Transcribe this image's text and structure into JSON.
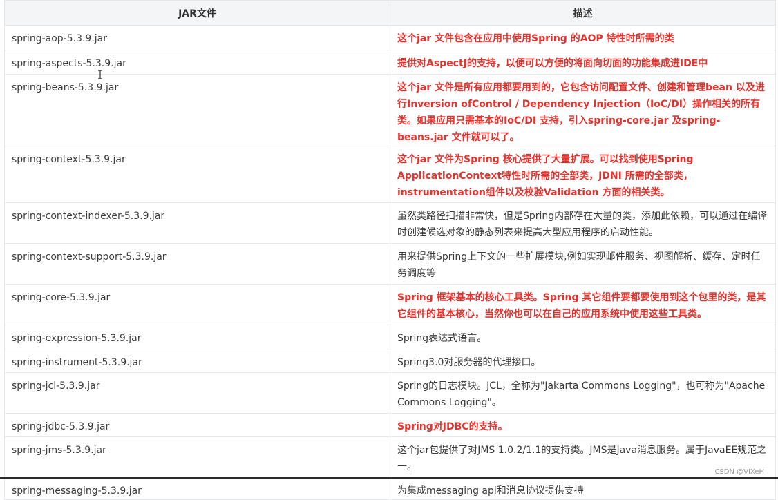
{
  "table": {
    "headers": [
      "JAR文件",
      "描述"
    ],
    "rows": [
      {
        "jar": "spring-aop-5.3.9.jar",
        "desc": "这个jar 文件包含在应用中使用Spring 的AOP 特性时所需的类",
        "highlight": true
      },
      {
        "jar": "spring-aspects-5.3.9.jar",
        "desc": "提供对AspectJ的支持，以便可以方便的将面向切面的功能集成进IDE中",
        "highlight": true
      },
      {
        "jar": "spring-beans-5.3.9.jar",
        "desc": "这个jar 文件是所有应用都要用到的，它包含访问配置文件、创建和管理bean 以及进行Inversion ofControl / Dependency Injection（IoC/DI）操作相关的所有类。如果应用只需基本的IoC/DI 支持，引入spring-core.jar 及spring-beans.jar 文件就可以了。",
        "highlight": true
      },
      {
        "jar": "spring-context-5.3.9.jar",
        "desc": "这个jar 文件为Spring 核心提供了大量扩展。可以找到使用Spring ApplicationContext特性时所需的全部类，JDNI 所需的全部类，instrumentation组件以及校验Validation 方面的相关类。",
        "highlight": true
      },
      {
        "jar": "spring-context-indexer-5.3.9.jar",
        "desc": "虽然类路径扫描非常快，但是Spring内部存在大量的类，添加此依赖，可以通过在编译时创建候选对象的静态列表来提高大型应用程序的启动性能。",
        "highlight": false
      },
      {
        "jar": "spring-context-support-5.3.9.jar",
        "desc": "用来提供Spring上下文的一些扩展模块,例如实现邮件服务、视图解析、缓存、定时任务调度等",
        "highlight": false
      },
      {
        "jar": "spring-core-5.3.9.jar",
        "desc": "Spring 框架基本的核心工具类。Spring 其它组件要都要使用到这个包里的类，是其它组件的基本核心，当然你也可以在自己的应用系统中使用这些工具类。",
        "highlight": true
      },
      {
        "jar": "spring-expression-5.3.9.jar",
        "desc": "Spring表达式语言。",
        "highlight": false
      },
      {
        "jar": "spring-instrument-5.3.9.jar",
        "desc": "Spring3.0对服务器的代理接口。",
        "highlight": false
      },
      {
        "jar": "spring-jcl-5.3.9.jar",
        "desc": "Spring的日志模块。JCL，全称为\"Jakarta Commons Logging\"，也可称为\"Apache Commons Logging\"。",
        "highlight": false
      },
      {
        "jar": "spring-jdbc-5.3.9.jar",
        "desc": "Spring对JDBC的支持。",
        "highlight": true
      },
      {
        "jar": "spring-jms-5.3.9.jar",
        "desc": "这个jar包提供了对JMS 1.0.2/1.1的支持类。JMS是Java消息服务。属于JavaEE规范之一。",
        "highlight": false
      },
      {
        "jar": "spring-messaging-5.3.9.jar",
        "desc": "为集成messaging api和消息协议提供支持",
        "highlight": false
      }
    ]
  },
  "watermark": "CSDN @VIXeH",
  "colors": {
    "highlight_text": "#e6322d",
    "normal_text": "#3a3a3a",
    "header_bg": "#f4f5f7",
    "border": "#e6e8eb"
  }
}
